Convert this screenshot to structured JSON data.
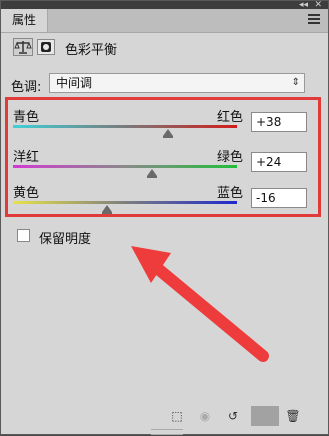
{
  "panel": {
    "tab_label": "属性",
    "title": "色彩平衡"
  },
  "tone": {
    "label": "色调:",
    "selected": "中间调"
  },
  "sliders": [
    {
      "left_label": "青色",
      "right_label": "红色",
      "value": "+38",
      "level": 38,
      "colors": [
        "#3fd0d8",
        "#7a7a7a",
        "#d11c1c"
      ]
    },
    {
      "left_label": "洋红",
      "right_label": "绿色",
      "value": "+24",
      "level": 24,
      "colors": [
        "#d23ad2",
        "#8a8a8a",
        "#1fbf3a"
      ]
    },
    {
      "left_label": "黄色",
      "right_label": "蓝色",
      "value": "-16",
      "level": -16,
      "colors": [
        "#e6e24a",
        "#7e7e7e",
        "#1d2ad0"
      ]
    }
  ],
  "preserve": {
    "label": "保留明度",
    "checked": false
  },
  "bottom_icons": [
    "clip-to-layer-icon",
    "visibility-eye-icon",
    "reset-icon",
    "toggle-layer-visibility-icon",
    "trash-icon"
  ]
}
